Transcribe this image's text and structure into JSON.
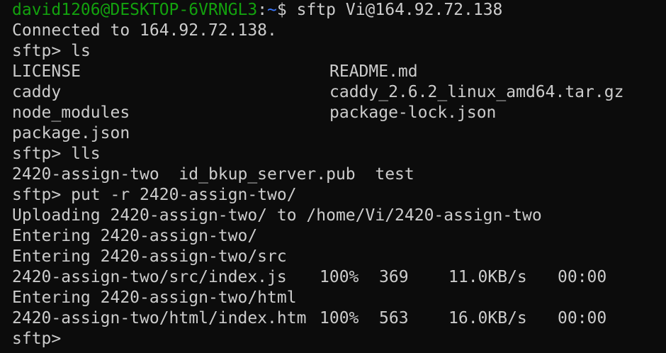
{
  "colors": {
    "background": "#0c0c0c",
    "text": "#cccccc",
    "prompt_user": "#13a10e",
    "prompt_path": "#3b78ff"
  },
  "shell_prompt": {
    "user_host": "david1206@DESKTOP-6VRNGL3",
    "colon": ":",
    "path": "~",
    "dollar": "$",
    "command": " sftp Vi@164.92.72.138"
  },
  "connected_line": "Connected to 164.92.72.138.",
  "sftp_prompt": "sftp> ",
  "cmd_ls": "ls",
  "ls_listing": [
    {
      "left": "LICENSE",
      "right": "README.md"
    },
    {
      "left": "caddy",
      "right": "caddy_2.6.2_linux_amd64.tar.gz"
    },
    {
      "left": "node_modules",
      "right": "package-lock.json"
    },
    {
      "left": "package.json",
      "right": ""
    }
  ],
  "cmd_lls": "lls",
  "lls_listing": "2420-assign-two  id_bkup_server.pub  test",
  "cmd_put": "put -r 2420-assign-two/",
  "upload_lines": {
    "uploading": "Uploading 2420-assign-two/ to /home/Vi/2420-assign-two",
    "entering_root": "Entering 2420-assign-two/",
    "entering_src": "Entering 2420-assign-two/src",
    "entering_html": "Entering 2420-assign-two/html"
  },
  "transfers": [
    {
      "file": "2420-assign-two/src/index.js",
      "percent": "100%",
      "size": "369",
      "rate": "11.0KB/s",
      "time": "00:00"
    },
    {
      "file": "2420-assign-two/html/index.htm",
      "percent": "100%",
      "size": "563",
      "rate": "16.0KB/s",
      "time": "00:00"
    }
  ]
}
